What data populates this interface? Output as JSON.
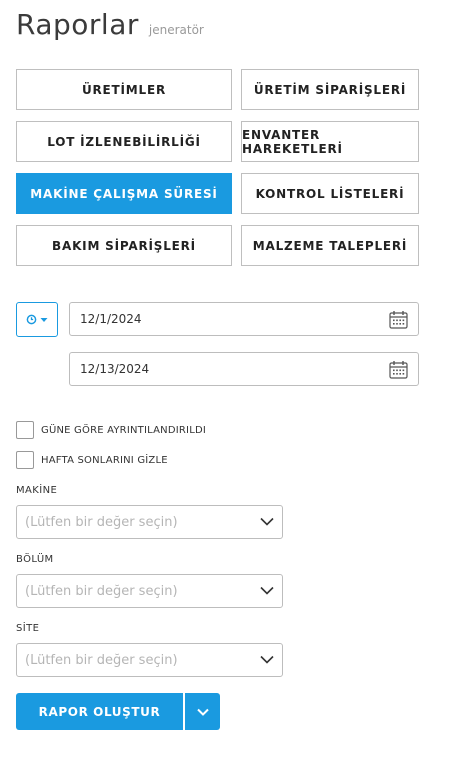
{
  "header": {
    "title": "Raporlar",
    "subtitle": "jeneratör"
  },
  "report_types": [
    {
      "label": "ÜRETİMLER"
    },
    {
      "label": "ÜRETİM SİPARİŞLERİ"
    },
    {
      "label": "LOT İZLENEBİLİRLİĞİ"
    },
    {
      "label": "ENVANTER HAREKETLERİ"
    },
    {
      "label": "MAKİNE ÇALIŞMA SÜRESİ",
      "selected": true
    },
    {
      "label": "KONTROL LİSTELERİ"
    },
    {
      "label": "BAKIM SİPARİŞLERİ"
    },
    {
      "label": "MALZEME TALEPLERİ"
    }
  ],
  "date_range": {
    "start": "12/1/2024",
    "end": "12/13/2024"
  },
  "options": {
    "daily_detail_label": "GÜNE GÖRE AYRINTILANDIRILDI",
    "daily_detail_checked": false,
    "hide_weekends_label": "HAFTA SONLARINI GİZLE",
    "hide_weekends_checked": false
  },
  "filters": {
    "machine": {
      "label": "MAKİNE",
      "placeholder": "(Lütfen bir değer seçin)"
    },
    "department": {
      "label": "BÖLÜM",
      "placeholder": "(Lütfen bir değer seçin)"
    },
    "site": {
      "label": "SİTE",
      "placeholder": "(Lütfen bir değer seçin)"
    }
  },
  "actions": {
    "generate_label": "RAPOR OLUŞTUR"
  },
  "colors": {
    "accent": "#1a9ae0",
    "border": "#bdbdbd",
    "placeholder": "#b5b5b5"
  }
}
